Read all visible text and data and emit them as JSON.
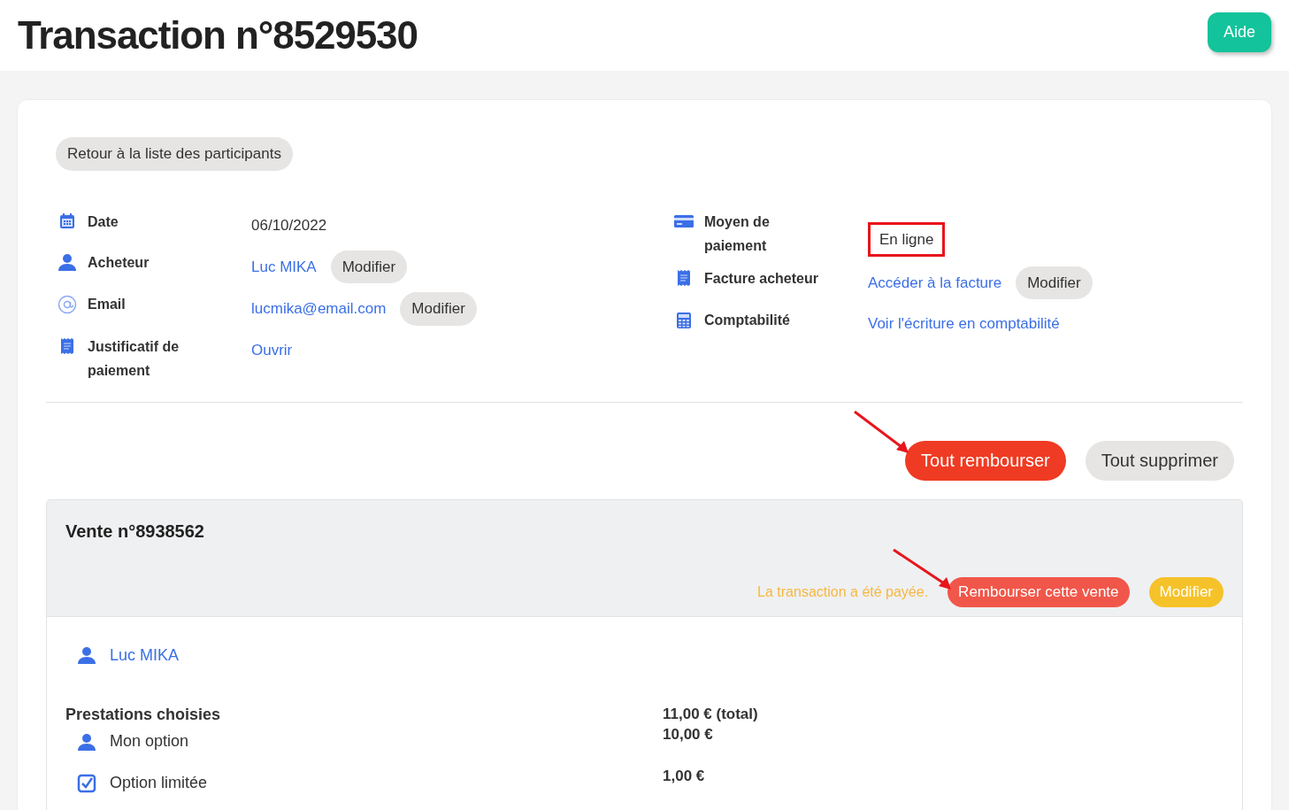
{
  "header": {
    "title": "Transaction n°8529530",
    "help_button": "Aide"
  },
  "back_button": "Retour à la liste des participants",
  "details_left": [
    {
      "kind": "calendar",
      "label": "Date",
      "value": "06/10/2022",
      "link": false,
      "highlighted": false
    },
    {
      "kind": "person",
      "label": "Acheteur",
      "value": "Luc MIKA",
      "link": true,
      "highlighted": false,
      "action": "Modifier"
    },
    {
      "kind": "at",
      "label": "Email",
      "value": "lucmika@email.com",
      "link": true,
      "highlighted": false,
      "action": "Modifier"
    },
    {
      "kind": "receipt",
      "label": "Justificatif de paiement",
      "value": "Ouvrir",
      "link": true,
      "highlighted": false
    }
  ],
  "details_right": [
    {
      "kind": "card",
      "label": "Moyen de paiement",
      "value": "En ligne",
      "link": false,
      "highlighted": true
    },
    {
      "kind": "receipt",
      "label": "Facture acheteur",
      "value": "Accéder à la facture",
      "link": true,
      "highlighted": false,
      "action": "Modifier"
    },
    {
      "kind": "calculator",
      "label": "Comptabilité",
      "value": "Voir l'écriture en comptabilité",
      "link": true,
      "highlighted": false
    }
  ],
  "actions": [
    {
      "label": "Tout rembourser",
      "kind": "danger"
    },
    {
      "label": "Tout supprimer",
      "kind": "neutral"
    }
  ],
  "sale": {
    "title": "Vente n°8938562",
    "status": "La transaction a été payée.",
    "buttons": [
      {
        "label": "Rembourser cette vente",
        "kind": "danger"
      },
      {
        "label": "Modifier",
        "kind": "warning"
      }
    ],
    "buyer": "Luc MIKA",
    "section_title": "Prestations choisies",
    "total": "11,00 € (total)",
    "items": [
      {
        "kind": "person",
        "label": "Mon option",
        "price": "10,00 €"
      },
      {
        "kind": "checkbox",
        "label": "Option limitée",
        "price": "1,00 €"
      }
    ]
  }
}
